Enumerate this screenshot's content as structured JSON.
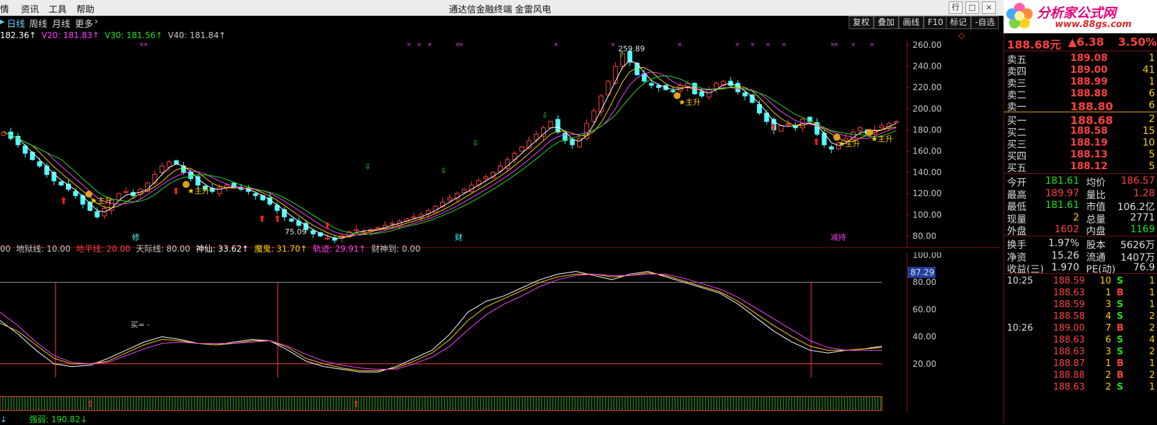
{
  "menu": {
    "items": [
      "情",
      "资讯",
      "工具",
      "帮助"
    ],
    "title": "通达信金融终端  金雷风电",
    "win_buttons": [
      "行",
      "□",
      "×"
    ]
  },
  "logo": {
    "line1": "分析家公式网",
    "line2": "www.88gs.com"
  },
  "period_tabs": [
    "日线",
    "周线",
    "月线",
    "更多"
  ],
  "toolbar": [
    "复权",
    "叠加",
    "画线",
    "F10",
    "标记",
    "-自选"
  ],
  "ma_legend": {
    "ma5": "182.36↑",
    "ma20": "V20: 181.83↑",
    "ma30": "V30: 181.56↑",
    "ma40": "V40: 181.84↑"
  },
  "price_axis": [
    "260.00",
    "240.00",
    "220.00",
    "200.00",
    "180.00",
    "160.00",
    "140.00",
    "120.00",
    "100.00",
    "80.00"
  ],
  "price_annotations": {
    "high": "259.89",
    "low": "75.09",
    "sign_left": "修",
    "sign_mid": "财",
    "sign_right": "减持",
    "main_up": "主升"
  },
  "indicator_legend": [
    {
      "text": "00",
      "color": "#c8c8c8"
    },
    {
      "text": "地狱线: 10.00",
      "color": "#c8c8c8"
    },
    {
      "text": "地平线: 20.00",
      "color": "#ff4040"
    },
    {
      "text": "天际线: 80.00",
      "color": "#c8c8c8"
    },
    {
      "text": "神仙: 33.62↑",
      "color": "#ffffff"
    },
    {
      "text": "魔鬼: 31.70↑",
      "color": "#ffd000"
    },
    {
      "text": "轨迹: 29.91↑",
      "color": "#ff40ff"
    },
    {
      "text": "财神到: 0.00",
      "color": "#c8c8c8"
    }
  ],
  "indicator_axis": [
    "100.00",
    "80.00",
    "60.00",
    "40.00",
    "20.00"
  ],
  "indicator_current": "87.29",
  "indicator_note": "买= -",
  "bottom_legend": {
    "arrow": "↓",
    "strength": "强弱: 190.82↓"
  },
  "quote": {
    "price": "188.68元",
    "change": "▲6.38",
    "pct": "3.50%",
    "asks": [
      {
        "label": "卖五",
        "price": "189.08",
        "vol": "1"
      },
      {
        "label": "卖四",
        "price": "189.00",
        "vol": "41"
      },
      {
        "label": "卖三",
        "price": "188.99",
        "vol": "1"
      },
      {
        "label": "卖二",
        "price": "188.88",
        "vol": "6"
      },
      {
        "label": "卖一",
        "price": "188.80",
        "vol": "6"
      }
    ],
    "bids": [
      {
        "label": "买一",
        "price": "188.68",
        "vol": "2"
      },
      {
        "label": "买二",
        "price": "188.58",
        "vol": "15"
      },
      {
        "label": "买三",
        "price": "188.19",
        "vol": "10"
      },
      {
        "label": "买四",
        "price": "188.13",
        "vol": "5"
      },
      {
        "label": "买五",
        "price": "188.12",
        "vol": "5"
      }
    ],
    "stats": [
      {
        "a": "今开",
        "b": "181.61",
        "bc": "#20e020",
        "c": "均价",
        "d": "186.57",
        "dc": "#ff4040"
      },
      {
        "a": "最高",
        "b": "189.97",
        "bc": "#ff4040",
        "c": "量比",
        "d": "1.28",
        "dc": "#ff4040"
      },
      {
        "a": "最低",
        "b": "181.61",
        "bc": "#20e020",
        "c": "市值",
        "d": "106.2亿",
        "dc": "#e0e0e0"
      },
      {
        "a": "现量",
        "b": "2",
        "bc": "#ffd000",
        "c": "总量",
        "d": "2771",
        "dc": "#e0e0e0"
      },
      {
        "a": "外盘",
        "b": "1602",
        "bc": "#ff4040",
        "c": "内盘",
        "d": "1169",
        "dc": "#20e020"
      }
    ],
    "stats2": [
      {
        "a": "换手",
        "b": "1.97%",
        "bc": "#e0e0e0",
        "c": "股本",
        "d": "5626万",
        "dc": "#e0e0e0"
      },
      {
        "a": "净资",
        "b": "15.26",
        "bc": "#e0e0e0",
        "c": "流通",
        "d": "1407万",
        "dc": "#e0e0e0"
      },
      {
        "a": "收益(三)",
        "b": "1.970",
        "bc": "#e0e0e0",
        "c": "PE(动)",
        "d": "76.9",
        "dc": "#e0e0e0"
      }
    ],
    "ticks": [
      {
        "t": "10:25",
        "p": "188.59",
        "v": "10",
        "bs": "S",
        "n": "1"
      },
      {
        "t": "",
        "p": "188.63",
        "v": "1",
        "bs": "B",
        "n": "1"
      },
      {
        "t": "",
        "p": "188.59",
        "v": "3",
        "bs": "S",
        "n": "1"
      },
      {
        "t": "",
        "p": "188.58",
        "v": "4",
        "bs": "S",
        "n": "2"
      },
      {
        "t": "10:26",
        "p": "189.00",
        "v": "7",
        "bs": "B",
        "n": "2"
      },
      {
        "t": "",
        "p": "188.63",
        "v": "6",
        "bs": "S",
        "n": "4"
      },
      {
        "t": "",
        "p": "188.63",
        "v": "3",
        "bs": "S",
        "n": "2"
      },
      {
        "t": "",
        "p": "188.87",
        "v": "1",
        "bs": "B",
        "n": "1"
      },
      {
        "t": "",
        "p": "188.88",
        "v": "2",
        "bs": "B",
        "n": "2"
      },
      {
        "t": "",
        "p": "188.63",
        "v": "2",
        "bs": "S",
        "n": "1"
      }
    ]
  },
  "colors": {
    "up": "#ff4040",
    "down": "#54ffff",
    "ma5": "#ffffff",
    "ma20": "#ffd000",
    "ma30": "#ff40ff",
    "ma40": "#20e020",
    "grid": "#8a1010"
  },
  "chart_data": {
    "type": "candlestick",
    "ylim": [
      75,
      262
    ],
    "close_series": [
      178,
      172,
      166,
      158,
      152,
      146,
      138,
      132,
      128,
      124,
      118,
      110,
      104,
      98,
      106,
      114,
      120,
      122,
      118,
      124,
      130,
      138,
      146,
      150,
      148,
      140,
      134,
      128,
      124,
      122,
      126,
      128,
      126,
      124,
      122,
      118,
      114,
      110,
      104,
      98,
      94,
      90,
      86,
      82,
      80,
      78,
      76,
      80,
      84,
      86,
      84,
      86,
      88,
      90,
      92,
      94,
      96,
      98,
      100,
      104,
      108,
      112,
      116,
      120,
      124,
      128,
      132,
      136,
      140,
      146,
      152,
      158,
      164,
      170,
      176,
      182,
      188,
      178,
      170,
      166,
      172,
      186,
      198,
      212,
      226,
      240,
      252,
      244,
      232,
      226,
      222,
      220,
      218,
      216,
      222,
      224,
      214,
      212,
      218,
      224,
      226,
      222,
      216,
      212,
      206,
      196,
      188,
      180,
      184,
      186,
      182,
      190,
      188,
      176,
      166,
      162,
      168,
      172,
      178,
      182,
      176,
      180,
      184,
      186,
      188
    ],
    "indicator_series": {
      "shenxian": [
        52,
        42,
        30,
        20,
        18,
        19,
        24,
        30,
        36,
        40,
        38,
        35,
        34,
        36,
        38,
        37,
        30,
        22,
        18,
        16,
        14,
        14,
        18,
        24,
        30,
        42,
        58,
        66,
        70,
        76,
        82,
        86,
        88,
        85,
        82,
        86,
        88,
        84,
        80,
        76,
        72,
        64,
        54,
        44,
        36,
        30,
        28,
        30,
        31,
        33
      ],
      "mogui": [
        50,
        44,
        34,
        24,
        20,
        20,
        22,
        28,
        34,
        38,
        37,
        35,
        34,
        35,
        37,
        37,
        32,
        24,
        20,
        17,
        15,
        15,
        17,
        22,
        28,
        38,
        52,
        62,
        68,
        74,
        80,
        84,
        86,
        86,
        84,
        85,
        87,
        85,
        81,
        77,
        73,
        66,
        57,
        48,
        40,
        33,
        30,
        30,
        31,
        32
      ],
      "guiji": [
        58,
        48,
        36,
        26,
        21,
        20,
        21,
        26,
        31,
        35,
        36,
        35,
        35,
        35,
        36,
        37,
        33,
        27,
        22,
        19,
        17,
        16,
        16,
        20,
        25,
        33,
        45,
        56,
        64,
        70,
        77,
        82,
        85,
        86,
        85,
        85,
        86,
        86,
        83,
        79,
        75,
        69,
        61,
        53,
        45,
        37,
        32,
        30,
        30,
        30
      ]
    }
  }
}
